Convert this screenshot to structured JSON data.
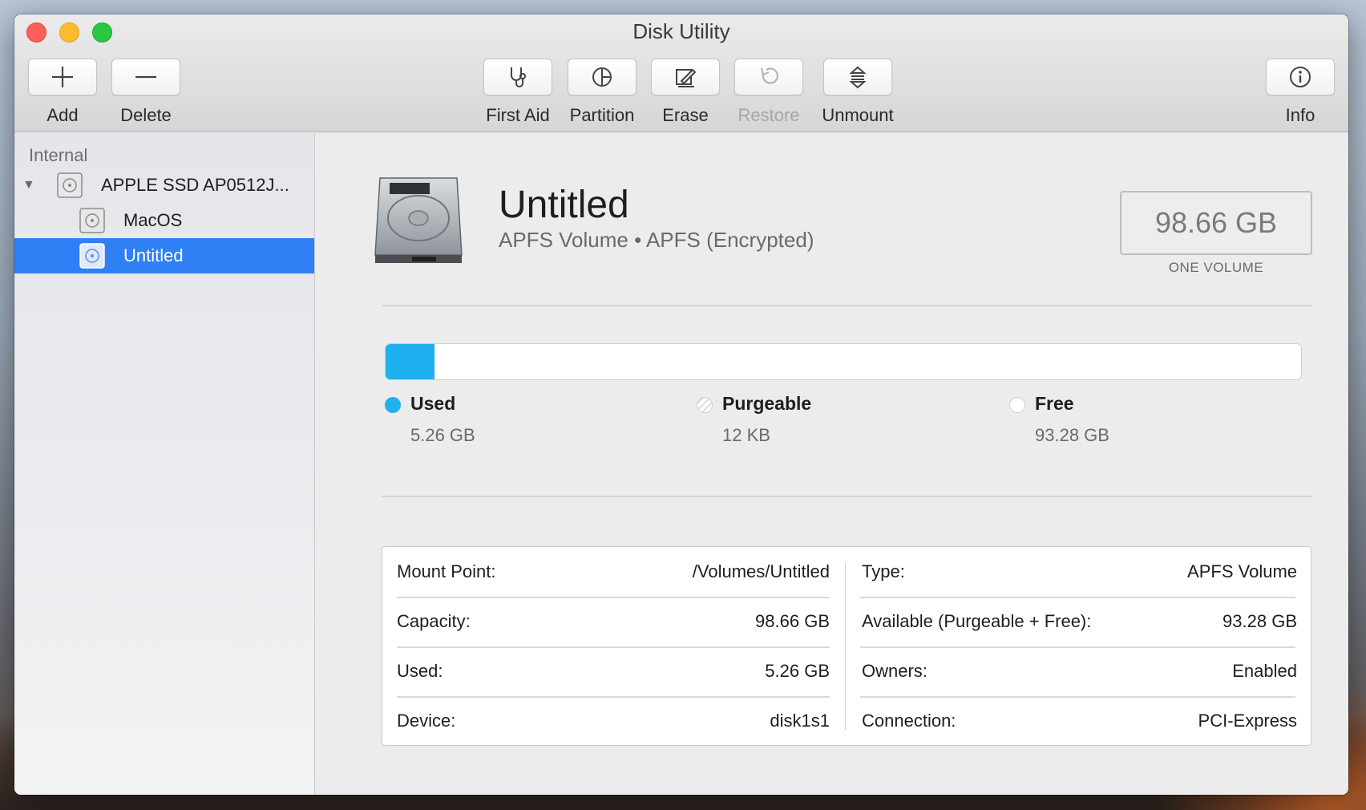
{
  "window": {
    "title": "Disk Utility"
  },
  "toolbar": {
    "add_label": "Add",
    "delete_label": "Delete",
    "first_aid_label": "First Aid",
    "partition_label": "Partition",
    "erase_label": "Erase",
    "restore_label": "Restore",
    "unmount_label": "Unmount",
    "info_label": "Info"
  },
  "sidebar": {
    "section": "Internal",
    "disk": {
      "label": "APPLE SSD AP0512J..."
    },
    "volumes": [
      {
        "label": "MacOS"
      },
      {
        "label": "Untitled",
        "selected": true
      }
    ]
  },
  "volume": {
    "name": "Untitled",
    "subtitle": "APFS Volume • APFS (Encrypted)",
    "size": "98.66 GB",
    "size_caption": "ONE VOLUME"
  },
  "usage": {
    "used_fraction": 0.0533,
    "colors": {
      "used": "#1fb0ef",
      "free": "#ffffff"
    },
    "legend": [
      {
        "name": "Used",
        "value": "5.26 GB"
      },
      {
        "name": "Purgeable",
        "value": "12 KB"
      },
      {
        "name": "Free",
        "value": "93.28 GB"
      }
    ]
  },
  "info": {
    "left": [
      {
        "key": "Mount Point:",
        "value": "/Volumes/Untitled"
      },
      {
        "key": "Capacity:",
        "value": "98.66 GB"
      },
      {
        "key": "Used:",
        "value": "5.26 GB"
      },
      {
        "key": "Device:",
        "value": "disk1s1"
      }
    ],
    "right": [
      {
        "key": "Type:",
        "value": "APFS Volume"
      },
      {
        "key": "Available (Purgeable + Free):",
        "value": "93.28 GB"
      },
      {
        "key": "Owners:",
        "value": "Enabled"
      },
      {
        "key": "Connection:",
        "value": "PCI-Express"
      }
    ]
  }
}
